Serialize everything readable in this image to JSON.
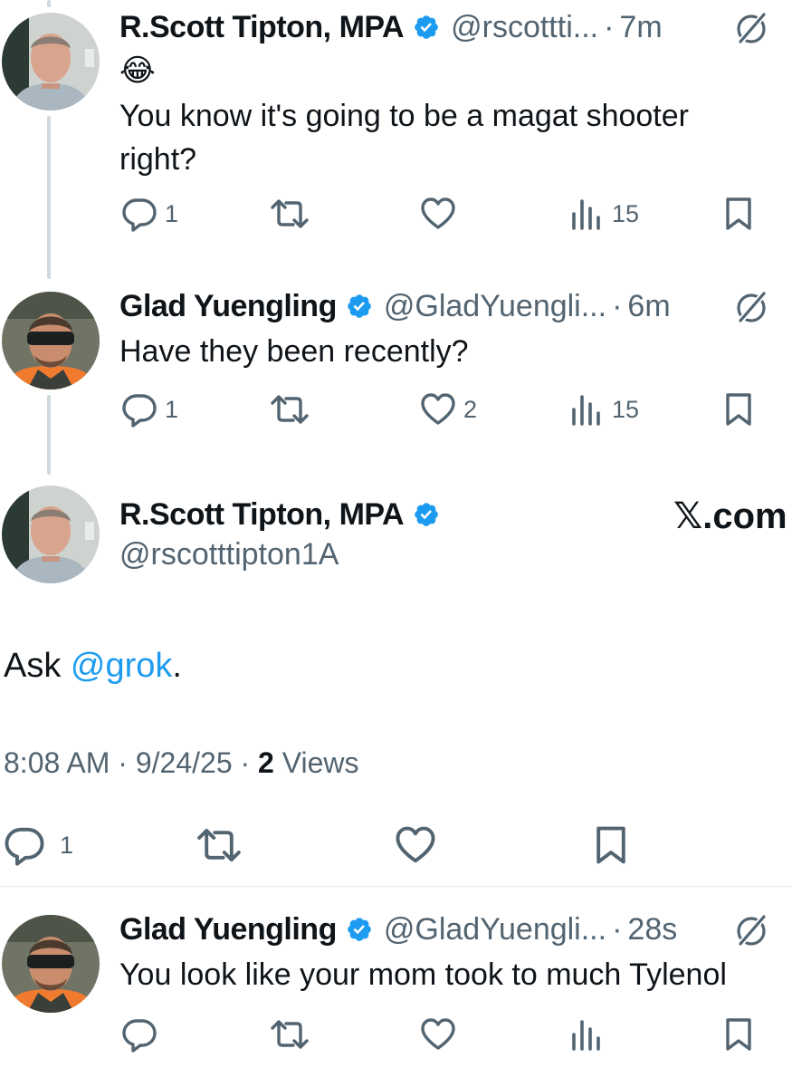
{
  "tweets": [
    {
      "name": "R.Scott Tipton, MPA",
      "handle": "@rscottti...",
      "dot": "·",
      "time": "7m",
      "emoji": "😂",
      "text": "You know it's going to be a magat shooter right?",
      "replies": "1",
      "views": "15"
    },
    {
      "name": "Glad Yuengling",
      "handle": "@GladYuengli...",
      "dot": "·",
      "time": "6m",
      "text": "Have they been recently?",
      "replies": "1",
      "likes": "2",
      "views": "15"
    }
  ],
  "focused": {
    "name": "R.Scott Tipton, MPA",
    "handle": "@rscotttipton1A",
    "watermark": "𝕏.com",
    "text_prefix": "Ask ",
    "mention": "@grok",
    "text_suffix": ".",
    "timestamp": "8:08 AM · 9/24/25 · ",
    "views_count": "2",
    "views_label": " Views",
    "replies": "1"
  },
  "reply": {
    "name": "Glad Yuengling",
    "handle": "@GladYuengli...",
    "dot": "·",
    "time": "28s",
    "text": "You look like your mom took to much Tylenol"
  },
  "colors": {
    "verified": "#1d9bf0",
    "link": "#1d9bf0",
    "secondary_text": "#536471",
    "thread_line": "#cfd9de"
  },
  "icons": [
    "verified-badge-icon",
    "grok-icon",
    "reply-icon",
    "retweet-icon",
    "like-icon",
    "views-icon",
    "bookmark-icon"
  ]
}
